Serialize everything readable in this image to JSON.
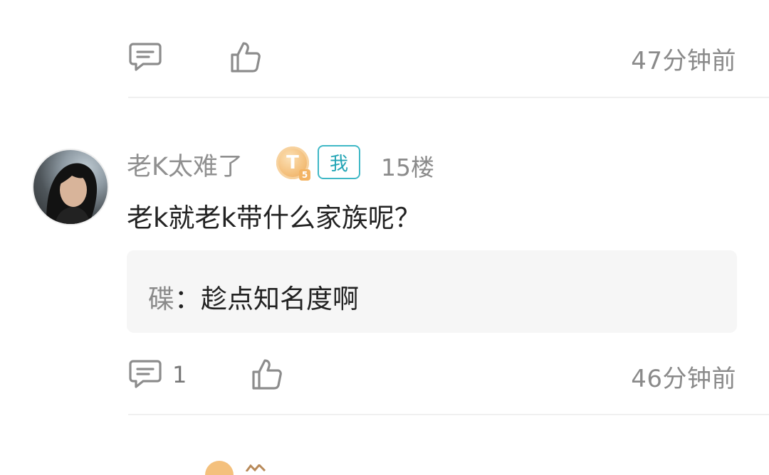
{
  "top_actions": {
    "comment_icon": "comment-bubble",
    "like_icon": "thumbs-up",
    "time": "47分钟前"
  },
  "comment": {
    "username": "老K太难了",
    "level_badge": {
      "letter": "T",
      "sub": "5"
    },
    "me_badge": "我",
    "floor": "15楼",
    "text": "老k就老k带什么家族呢？",
    "reply": {
      "name": "碟",
      "separator": "：",
      "text": "趁点知名度啊"
    },
    "actions": {
      "comment_icon": "comment-bubble",
      "reply_count": "1",
      "like_icon": "thumbs-up",
      "time": "46分钟前"
    }
  },
  "colors": {
    "accent": "#3fb8c6",
    "badge_gold": "#f4c07c",
    "muted": "#8a8a8a"
  }
}
